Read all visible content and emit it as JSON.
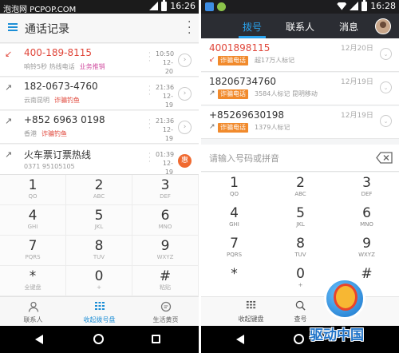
{
  "watermark": "泡泡网 PCPOP.COM",
  "left": {
    "status_time": "16:26",
    "title": "通话记录",
    "calls": [
      {
        "number": "400-189-8115",
        "sub1": "响铃5秒",
        "sub2": "热线电话",
        "tag": "业务推销",
        "time1": "10:50",
        "time2": "12-20",
        "missed": true,
        "extra": "chevron"
      },
      {
        "number": "182-0673-4760",
        "sub1": "云南昆明",
        "sub2": "",
        "tag": "诈骗钓鱼",
        "time1": "21:36",
        "time2": "12-19",
        "missed": false,
        "extra": "chevron"
      },
      {
        "number": "+852 6963 0198",
        "sub1": "香港",
        "sub2": "",
        "tag": "诈骗钓鱼",
        "time1": "21:36",
        "time2": "12-19",
        "missed": false,
        "extra": "chevron"
      },
      {
        "number": "火车票订票热线",
        "sub1": "0371 95105105",
        "sub2": "",
        "tag": "",
        "time1": "01:39",
        "time2": "12-19",
        "missed": false,
        "extra": "惠"
      }
    ],
    "keys": [
      {
        "d": "1",
        "s": "QO"
      },
      {
        "d": "2",
        "s": "ABC"
      },
      {
        "d": "3",
        "s": "DEF"
      },
      {
        "d": "4",
        "s": "GHI"
      },
      {
        "d": "5",
        "s": "JKL"
      },
      {
        "d": "6",
        "s": "MNO"
      },
      {
        "d": "7",
        "s": "PQRS"
      },
      {
        "d": "8",
        "s": "TUV"
      },
      {
        "d": "9",
        "s": "WXYZ"
      },
      {
        "d": "*",
        "s": "全键盘"
      },
      {
        "d": "0",
        "s": "+"
      },
      {
        "d": "#",
        "s": "粘贴"
      }
    ],
    "tabs": [
      {
        "icon": "person-icon",
        "label": "联系人"
      },
      {
        "icon": "dialpad-icon",
        "label": "收起拨号盘"
      },
      {
        "icon": "chat-icon",
        "label": "生活黄页"
      }
    ]
  },
  "right": {
    "status_time": "16:28",
    "tabs": [
      "拨号",
      "联系人",
      "消息"
    ],
    "calls": [
      {
        "number": "4001898115",
        "tag": "诈骗电话",
        "sub": "超17万人标记",
        "date": "12月20日",
        "missed": true
      },
      {
        "number": "18206734760",
        "tag": "诈骗电话",
        "sub": "3584人标记  昆明移动",
        "date": "12月19日",
        "missed": false
      },
      {
        "number": "+85269630198",
        "tag": "诈骗电话",
        "sub": "1379人标记",
        "date": "12月19日",
        "missed": false
      }
    ],
    "input_placeholder": "请输入号码或拼音",
    "keys": [
      {
        "d": "1",
        "s": "QO"
      },
      {
        "d": "2",
        "s": "ABC"
      },
      {
        "d": "3",
        "s": "DEF"
      },
      {
        "d": "4",
        "s": "GHI"
      },
      {
        "d": "5",
        "s": "JKL"
      },
      {
        "d": "6",
        "s": "MNO"
      },
      {
        "d": "7",
        "s": "PQRS"
      },
      {
        "d": "8",
        "s": "TUV"
      },
      {
        "d": "9",
        "s": "WXYZ"
      },
      {
        "d": "*",
        "s": ""
      },
      {
        "d": "0",
        "s": "+"
      },
      {
        "d": "#",
        "s": ""
      }
    ],
    "bottom_tabs": [
      {
        "icon": "dialpad-icon",
        "label": "收起键盘"
      },
      {
        "icon": "search-icon",
        "label": "查号"
      }
    ],
    "logo_text": "驱动中国"
  },
  "colors": {
    "accent_blue": "#1c8ed6",
    "missed_red": "#e0463a",
    "tag_orange": "#f18a2c",
    "header_dark": "#2b2d33"
  }
}
